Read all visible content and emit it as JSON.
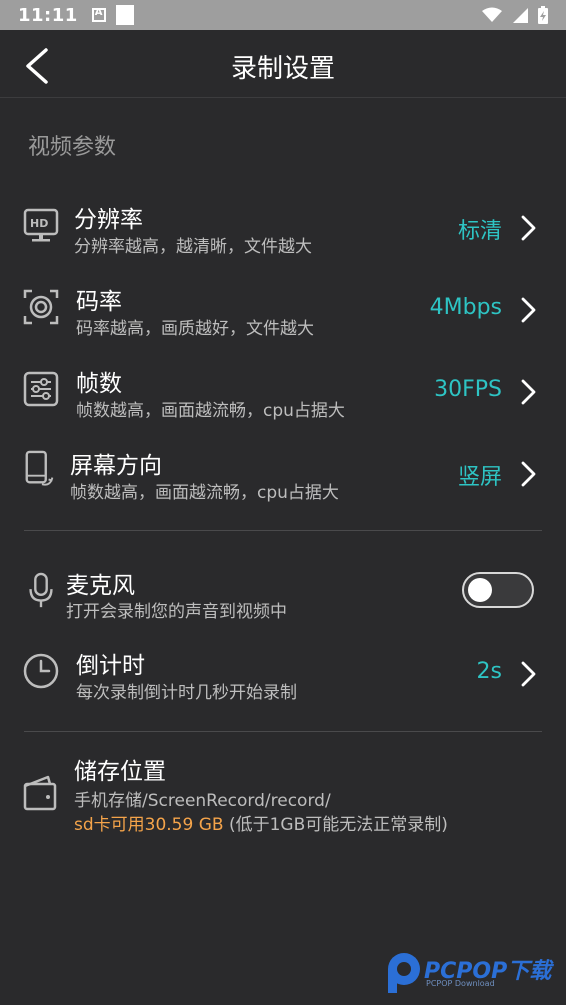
{
  "status_bar": {
    "time": "11:11",
    "icons": [
      "notification-a-icon",
      "square-icon",
      "wifi-icon",
      "signal-icon",
      "battery-charging-icon"
    ]
  },
  "app_bar": {
    "title": "录制设置",
    "back_icon": "chevron-left-icon"
  },
  "video_section": {
    "title": "视频参数",
    "items": [
      {
        "icon": "hd-monitor-icon",
        "title": "分辨率",
        "subtitle": "分辨率越高，越清晰，文件越大",
        "value": "标清"
      },
      {
        "icon": "camera-lens-icon",
        "title": "码率",
        "subtitle": "码率越高，画质越好，文件越大",
        "value": "4Mbps"
      },
      {
        "icon": "sliders-icon",
        "title": "帧数",
        "subtitle": "帧数越高，画面越流畅，cpu占据大",
        "value": "30FPS"
      },
      {
        "icon": "phone-rotate-icon",
        "title": "屏幕方向",
        "subtitle": "帧数越高，画面越流畅，cpu占据大",
        "value": "竖屏"
      }
    ]
  },
  "audio_section": {
    "mic": {
      "icon": "microphone-icon",
      "title": "麦克风",
      "subtitle": "打开会录制您的声音到视频中",
      "enabled": false
    },
    "countdown": {
      "icon": "clock-icon",
      "title": "倒计时",
      "subtitle": "每次录制倒计时几秒开始录制",
      "value": "2s"
    }
  },
  "storage": {
    "icon": "wallet-icon",
    "title": "储存位置",
    "path": "手机存储/ScreenRecord/record/",
    "available": "sd卡可用30.59 GB",
    "note": " (低于1GB可能无法正常录制)"
  },
  "watermark": {
    "text": "PCPOP下载",
    "sub": "PCPOP Download"
  },
  "colors": {
    "background": "#2a2a2c",
    "accent": "#2ec4c4",
    "warning": "#f5a44a",
    "status_bar": "#9e9e9e"
  }
}
